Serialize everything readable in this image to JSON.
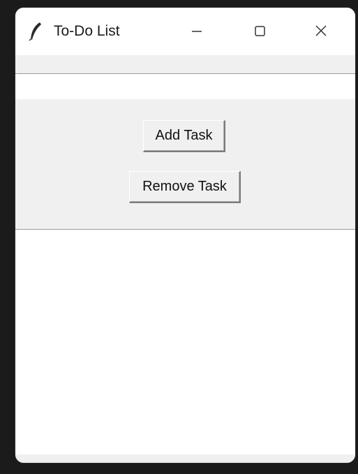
{
  "window": {
    "title": "To-Do List",
    "icon": "feather-icon",
    "controls": {
      "minimize_icon": "minimize-icon",
      "maximize_icon": "maximize-icon",
      "close_icon": "close-icon"
    }
  },
  "task_entry": {
    "value": ""
  },
  "buttons": {
    "add_label": "Add Task",
    "remove_label": "Remove Task"
  },
  "task_list": {
    "items": []
  },
  "colors": {
    "frame_background": "#f0f0f0",
    "window_background": "#ffffff",
    "separator": "#9a9a9a"
  }
}
